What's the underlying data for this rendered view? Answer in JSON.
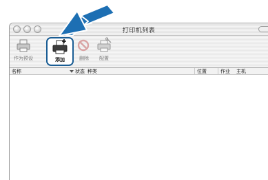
{
  "window": {
    "title": "打印机列表"
  },
  "toolbar": {
    "items": [
      {
        "label": "作为预设",
        "icon": "printer-default-icon"
      },
      {
        "label": "添加",
        "icon": "printer-add-icon"
      },
      {
        "label": "删除",
        "icon": "delete-icon"
      },
      {
        "label": "配置",
        "icon": "configure-icon"
      }
    ]
  },
  "table": {
    "columns": [
      "名称",
      "状态",
      "种类",
      "位置",
      "作业",
      "主机"
    ],
    "rows": []
  },
  "colors": {
    "highlight_border": "#1a5d94",
    "callout_arrow": "#1d6fb3"
  }
}
